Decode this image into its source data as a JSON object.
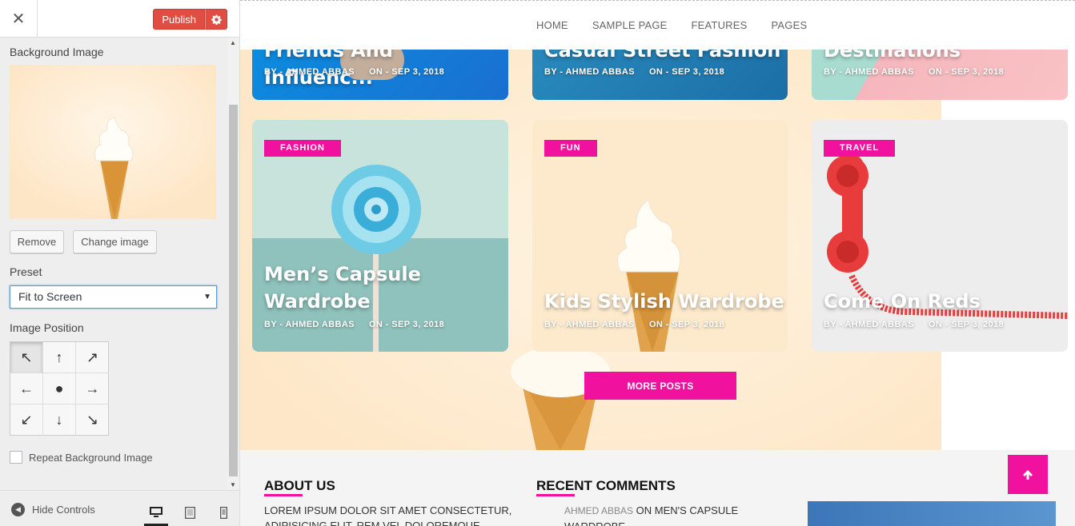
{
  "sidebar": {
    "close_label": "✕",
    "publish_label": "Publish",
    "section_label": "Background Image",
    "remove_label": "Remove",
    "change_label": "Change image",
    "preset_label": "Preset",
    "preset_value": "Fit to Screen",
    "position_label": "Image Position",
    "repeat_label": "Repeat Background Image",
    "hide_controls_label": "Hide Controls"
  },
  "nav": {
    "items": [
      "HOME",
      "SAMPLE PAGE",
      "FEATURES",
      "PAGES"
    ]
  },
  "cards_top": [
    {
      "title": "Friends And Influenc...",
      "author": "BY - AHMED ABBAS",
      "date": "ON - SEP 3, 2018"
    },
    {
      "title": "Casual Street Fashion",
      "author": "BY - AHMED ABBAS",
      "date": "ON - SEP 3, 2018"
    },
    {
      "title": "Destinations",
      "author": "BY - AHMED ABBAS",
      "date": "ON - SEP 3, 2018"
    }
  ],
  "cards": [
    {
      "category": "FASHION",
      "title_line1": "Men’s Capsule",
      "title_line2": "Wardrobe",
      "author": "BY - AHMED ABBAS",
      "date": "ON - SEP 3, 2018"
    },
    {
      "category": "FUN",
      "title": "Kids Stylish Wardrobe",
      "author": "BY - AHMED ABBAS",
      "date": "ON - SEP 3, 2018"
    },
    {
      "category": "TRAVEL",
      "title": "Come On Reds",
      "author": "BY - AHMED ABBAS",
      "date": "ON - SEP 3, 2018"
    }
  ],
  "more_posts_label": "MORE POSTS",
  "footer": {
    "about_title": "ABOUT US",
    "about_text_1": "LOREM IPSUM DOLOR SIT AMET CONSECTETUR,",
    "about_text_2": "ADIPISICING ELIT. REM VEL DOLOREMQUE",
    "comments_title": "RECENT COMMENTS",
    "comment_author": "AHMED ABBAS",
    "comment_on": "ON MEN'S CAPSULE",
    "comment_on_2": "WARDROBE"
  },
  "colors": {
    "accent": "#f0119f",
    "publish": "#e14d43",
    "bg_peach": "#fdebd1"
  }
}
